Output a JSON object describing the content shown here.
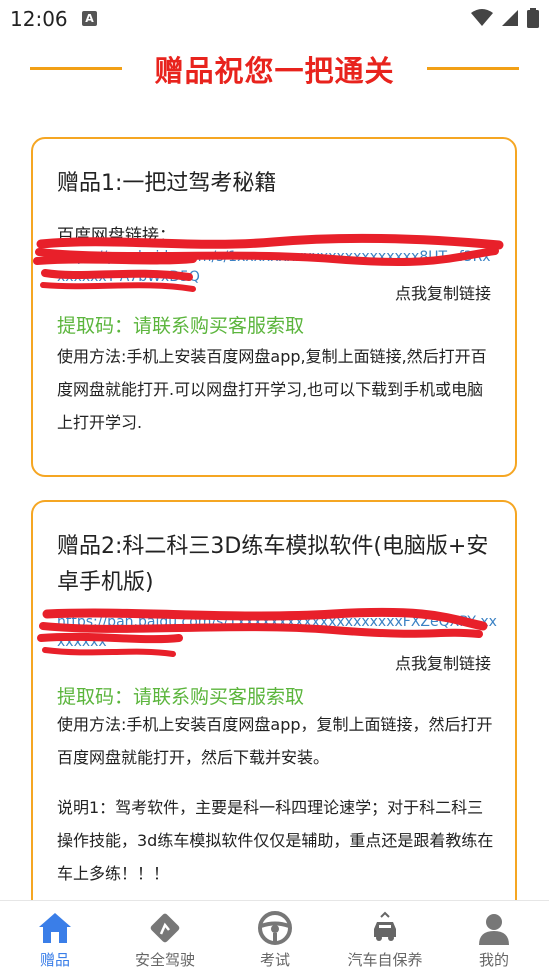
{
  "status_bar": {
    "time": "12:06",
    "notification_letter": "A"
  },
  "header": {
    "title": "赠品祝您一把通关"
  },
  "gifts": [
    {
      "title": "赠品1:一把过驾考秘籍",
      "link_label": "百度网盘链接：",
      "link_text": "https://pan.baidu.com/s/1xxxxxxxxxxxxxxxxxxxxxx8UT...f3RxxxxxxxT A7bWxD5Q",
      "copy_label": "点我复制链接",
      "code_label": "提取码：请联系购买客服索取",
      "usage": "使用方法:手机上安装百度网盘app,复制上面链接,然后打开百度网盘就能打开.可以网盘打开学习,也可以下载到手机或电脑上打开学习."
    },
    {
      "title": "赠品2:科二科三3D练车模拟软件(电脑版+安卓手机版)",
      "link_text": "https://pan.baidu.com/s/1xxxxxxxxxxxxxxxxxxxxFXZeQXPY xxxxxxxx",
      "copy_label": "点我复制链接",
      "code_label": "提取码：请联系购买客服索取",
      "usage": "使用方法:手机上安装百度网盘app，复制上面链接，然后打开百度网盘就能打开，然后下载并安装。",
      "note": "说明1：驾考软件，主要是科一科四理论速学；对于科二科三操作技能，3d练车模拟软件仅仅是辅助，重点还是跟着教练在车上多练！！！"
    }
  ],
  "tabs": [
    {
      "label": "赠品",
      "icon": "home-icon",
      "active": true
    },
    {
      "label": "安全驾驶",
      "icon": "safe-driving-icon",
      "active": false
    },
    {
      "label": "考试",
      "icon": "steering-wheel-icon",
      "active": false
    },
    {
      "label": "汽车自保养",
      "icon": "car-maintenance-icon",
      "active": false
    },
    {
      "label": "我的",
      "icon": "profile-icon",
      "active": false
    }
  ],
  "colors": {
    "accent": "#f5a623",
    "title_red": "#e8231d",
    "code_green": "#5bb53c",
    "tab_active": "#3a7ee8",
    "redaction": "#e8202a"
  }
}
